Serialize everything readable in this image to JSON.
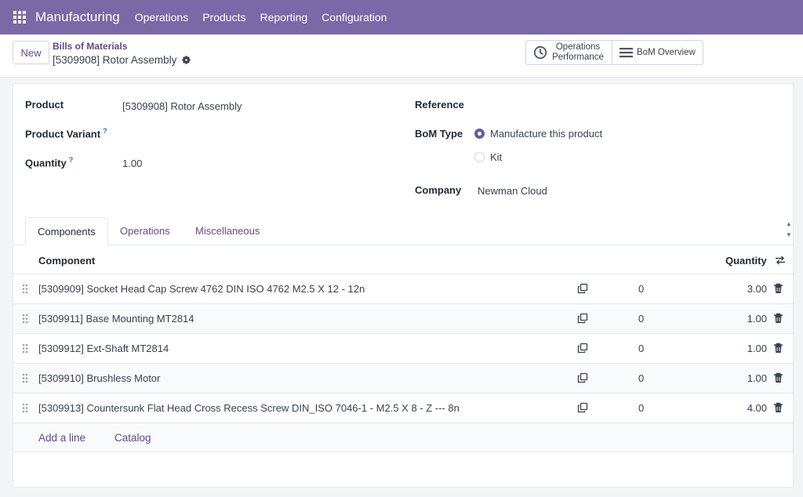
{
  "topbar": {
    "app_name": "Manufacturing",
    "menu": [
      "Operations",
      "Products",
      "Reporting",
      "Configuration"
    ]
  },
  "control": {
    "new_label": "New",
    "breadcrumb": "Bills of Materials",
    "record_title": "[5309908] Rotor Assembly",
    "stat_performance": "Operations Performance",
    "stat_overview": "BoM Overview"
  },
  "form": {
    "product_label": "Product",
    "product_value": "[5309908] Rotor Assembly",
    "variant_label": "Product Variant",
    "quantity_label": "Quantity",
    "quantity_value": "1.00",
    "help_mark": "?",
    "reference_label": "Reference",
    "bom_type_label": "BoM Type",
    "bom_type_options": [
      "Manufacture this product",
      "Kit"
    ],
    "bom_type_selected": "Manufacture this product",
    "company_label": "Company",
    "company_value": "Newman Cloud"
  },
  "tabs": [
    "Components",
    "Operations",
    "Miscellaneous"
  ],
  "active_tab": "Components",
  "table": {
    "col_component": "Component",
    "col_quantity": "Quantity",
    "rows": [
      {
        "name": "[5309909] Socket Head Cap Screw 4762 DIN ISO 4762 M2.5 X 12 - 12n",
        "zero": "0",
        "qty": "3.00"
      },
      {
        "name": "[5309911] Base Mounting MT2814",
        "zero": "0",
        "qty": "1.00"
      },
      {
        "name": "[5309912] Ext-Shaft MT2814",
        "zero": "0",
        "qty": "1.00"
      },
      {
        "name": "[5309910] Brushless Motor",
        "zero": "0",
        "qty": "1.00"
      },
      {
        "name": "[5309913] Countersunk Flat Head Cross Recess Screw DIN_ISO 7046-1 - M2.5 X 8 - Z --- 8n",
        "zero": "0",
        "qty": "4.00"
      }
    ],
    "add_line": "Add a line",
    "catalog": "Catalog"
  },
  "colors": {
    "brand": "#7b68a6",
    "link": "#5e4b87"
  }
}
